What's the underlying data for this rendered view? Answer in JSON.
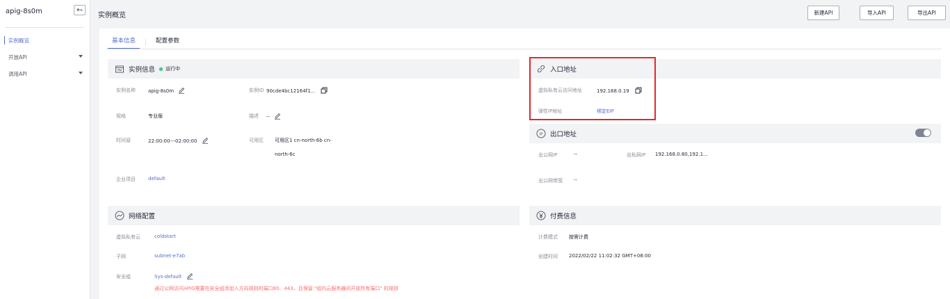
{
  "sidebar": {
    "title": "apig-8s0m",
    "items": [
      {
        "label": "实例概览"
      },
      {
        "label": "开放API"
      },
      {
        "label": "调用API"
      }
    ]
  },
  "header": {
    "title": "实例概览",
    "buttons": {
      "new_api": "新建API",
      "import_api": "导入API",
      "export_api": "导出API"
    }
  },
  "tabs": [
    {
      "label": "基本信息"
    },
    {
      "label": "配置参数"
    }
  ],
  "instance_info": {
    "title": "实例信息",
    "status": "运行中",
    "name_label": "实例名称",
    "name_value": "apig-8s0m",
    "id_label": "实例ID",
    "id_value": "90cde4bc12164f1...",
    "spec_label": "规格",
    "spec_value": "专业版",
    "desc_label": "描述",
    "desc_value": "--",
    "window_label": "时间窗",
    "window_value": "22:00:00---02:00:00",
    "az_label": "可用区",
    "az_value_1": "可用区1 cn-north-6b cn-",
    "az_value_2": "north-6c",
    "project_label": "企业项目",
    "project_value": "default"
  },
  "entry": {
    "title": "入口地址",
    "vpc_label": "虚拟私有云访问地址",
    "vpc_value": "192.168.0.19",
    "eip_label": "弹性IP地址",
    "eip_value": "绑定EIP"
  },
  "exit": {
    "title": "出口地址",
    "public_ip_label": "出公网IP",
    "public_ip_value": "--",
    "private_ip_label": "出私网IP",
    "private_ip_value": "192.168.0.80,192.1...",
    "bandwidth_label": "出公网带宽",
    "bandwidth_value": "--"
  },
  "network": {
    "title": "网络配置",
    "vpc_label": "虚拟私有云",
    "vpc_value": "coldstart",
    "subnet_label": "子网",
    "subnet_value": "subnet-e7ab",
    "sg_label": "安全组",
    "sg_value": "Sys-default",
    "warning": "通过公网访问APIG需要在安全组添加入方向规则的端口80、443，且保留 \"组内云服务器间开放所有端口\" 的规则"
  },
  "billing": {
    "title": "付费信息",
    "mode_label": "计费模式",
    "mode_value": "按需计费",
    "created_label": "创建时间",
    "created_value": "2022/02/22 11:02:32 GMT+08:00"
  },
  "colors": {
    "accent": "#526ecc",
    "status_ok": "#50c28c",
    "warning": "#f66f6a",
    "highlight": "#e0262d"
  }
}
